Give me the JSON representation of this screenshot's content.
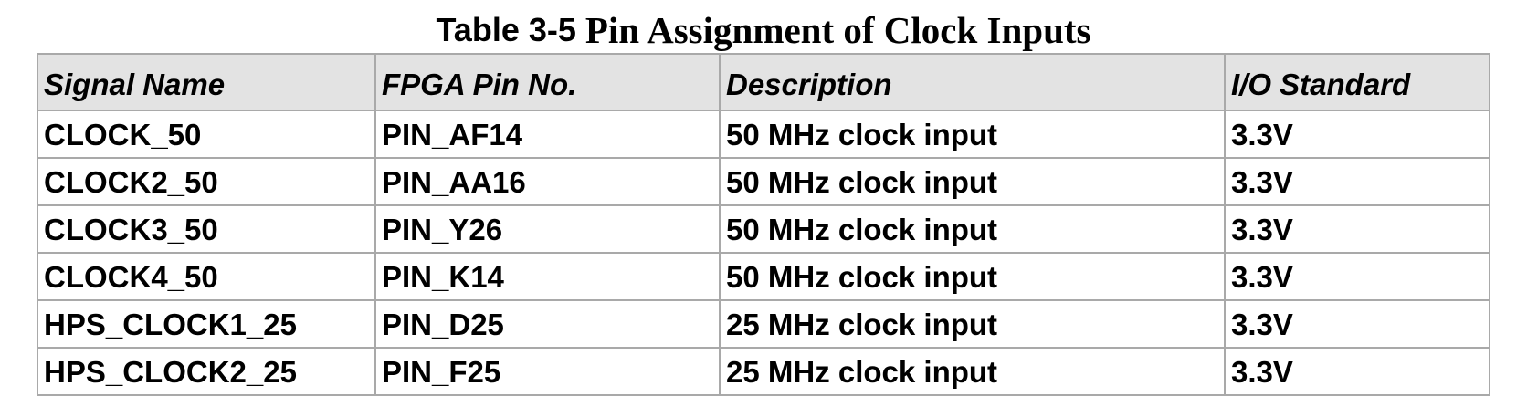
{
  "caption": {
    "number": "Table 3-5",
    "title": "Pin Assignment of Clock Inputs"
  },
  "table": {
    "headers": [
      "Signal Name",
      "FPGA Pin No.",
      "Description",
      "I/O Standard"
    ],
    "rows": [
      [
        "CLOCK_50",
        "PIN_AF14",
        "50 MHz clock input",
        "3.3V"
      ],
      [
        "CLOCK2_50",
        "PIN_AA16",
        "50 MHz clock input",
        "3.3V"
      ],
      [
        "CLOCK3_50",
        "PIN_Y26",
        "50 MHz clock input",
        "3.3V"
      ],
      [
        "CLOCK4_50",
        "PIN_K14",
        "50 MHz clock input",
        "3.3V"
      ],
      [
        "HPS_CLOCK1_25",
        "PIN_D25",
        "25 MHz clock input",
        "3.3V"
      ],
      [
        "HPS_CLOCK2_25",
        "PIN_F25",
        "25 MHz clock input",
        "3.3V"
      ]
    ]
  },
  "colors": {
    "header_background": "#e3e3e3",
    "grid_lines": "#a9a9a9",
    "text": "#000000"
  }
}
